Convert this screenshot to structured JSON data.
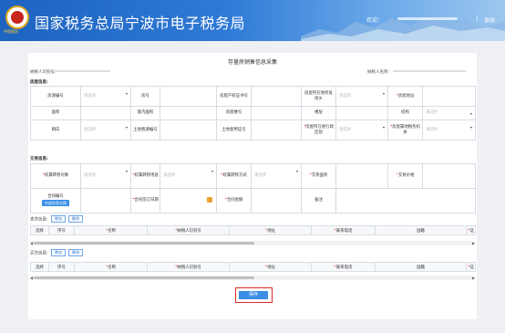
{
  "header": {
    "title": "国家税务总局宁波市电子税务局",
    "logo_text": "中国税务",
    "welcome": "欢迎：",
    "separator": "|",
    "logout": "退出"
  },
  "page_title": "存量房销售信息采集",
  "taxpayer": {
    "id_label": "纳税人识别号:",
    "name_label": "纳税人名称:"
  },
  "house_section": {
    "title": "房屋信息:",
    "rows": [
      [
        "房源编号",
        "请选择",
        "房号",
        "",
        "房屋产权证书号",
        "",
        "房屋所在地所处街乡",
        "请选择",
        "*房屋地址",
        ""
      ],
      [
        "面积",
        "",
        "套内面积",
        "",
        "房屋楼号",
        "",
        "楼层",
        "",
        "结构",
        "请选择"
      ],
      [
        "朝向",
        "请选择",
        "土地税源编号",
        "",
        "土地使用证号",
        "",
        "*房屋所在地行政区划",
        "请选择",
        "*房屋属地税务机关",
        "请选择"
      ]
    ]
  },
  "transaction_section": {
    "title": "交易信息:",
    "row1": {
      "object_label": "*权属转移对象",
      "object_value": "请选择",
      "use_label": "*权属转移用途",
      "use_value": "请选择",
      "way_label": "*权属转移方式",
      "way_value": "请选择",
      "area_label": "*交易面积",
      "price_label": "*交易价格"
    },
    "row2": {
      "contract_no_label": "合同编号",
      "exchange_button": "外部信息交换",
      "sign_date_label": "*合同签订日期",
      "amount_label": "*合同金额",
      "remark_label": "备注"
    }
  },
  "seller": {
    "title": "卖方信息:",
    "add": "增加",
    "delete": "删除",
    "columns": [
      "选择",
      "序号",
      "*名称",
      "*纳税人识别号",
      "*地址",
      "*联系电话",
      "国籍",
      "*证"
    ]
  },
  "buyer": {
    "title": "买方信息:",
    "add": "增加",
    "delete": "删除",
    "columns": [
      "选择",
      "序号",
      "*名称",
      "*纳税人识别号",
      "*地址",
      "*联系电话",
      "国籍",
      "*证"
    ]
  },
  "scroll": {
    "left": "◀",
    "right": "▶"
  },
  "save_label": "保存"
}
